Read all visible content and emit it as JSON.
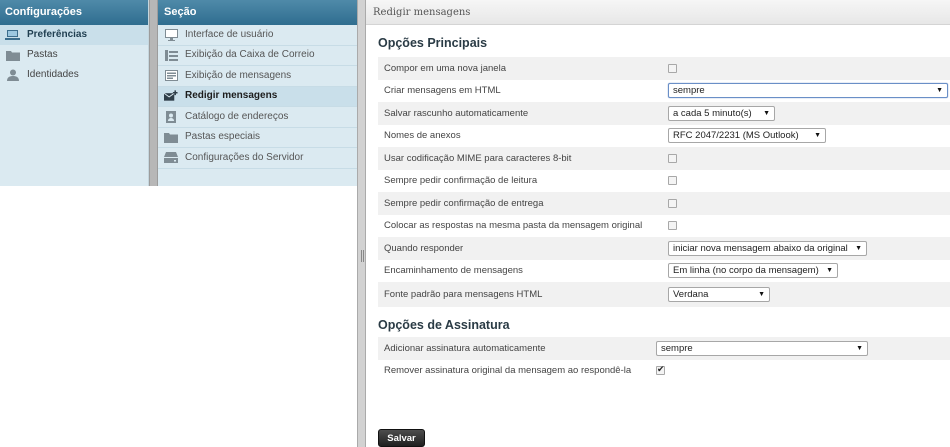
{
  "config": {
    "title": "Configurações",
    "items": [
      {
        "label": "Preferências",
        "icon": "laptop-icon"
      },
      {
        "label": "Pastas",
        "icon": "folder-icon"
      },
      {
        "label": "Identidades",
        "icon": "user-icon"
      }
    ]
  },
  "section": {
    "title": "Seção",
    "items": [
      {
        "label": "Interface de usuário",
        "icon": "monitor-icon"
      },
      {
        "label": "Exibição da Caixa de Correio",
        "icon": "mailbox-view-icon"
      },
      {
        "label": "Exibição de mensagens",
        "icon": "message-view-icon"
      },
      {
        "label": "Redigir mensagens",
        "icon": "compose-icon"
      },
      {
        "label": "Catálogo de endereços",
        "icon": "address-book-icon"
      },
      {
        "label": "Pastas especiais",
        "icon": "folder-icon"
      },
      {
        "label": "Configurações do Servidor",
        "icon": "server-icon"
      }
    ]
  },
  "main": {
    "title": "Redigir mensagens",
    "main_options": {
      "title": "Opções Principais",
      "rows": [
        {
          "label": "Compor em uma nova janela",
          "checked": false
        },
        {
          "label": "Criar mensagens em HTML",
          "value": "sempre"
        },
        {
          "label": "Salvar rascunho automaticamente",
          "value": "a cada 5 minuto(s)"
        },
        {
          "label": "Nomes de anexos",
          "value": "RFC 2047/2231 (MS Outlook)"
        },
        {
          "label": "Usar codificação MIME para caracteres 8-bit",
          "checked": false
        },
        {
          "label": "Sempre pedir confirmação de leitura",
          "checked": false
        },
        {
          "label": "Sempre pedir confirmação de entrega",
          "checked": false
        },
        {
          "label": "Colocar as respostas na mesma pasta da mensagem original",
          "checked": false
        },
        {
          "label": "Quando responder",
          "value": "iniciar nova mensagem abaixo da original"
        },
        {
          "label": "Encaminhamento de mensagens",
          "value": "Em linha (no corpo da mensagem)"
        },
        {
          "label": "Fonte padrão para mensagens HTML",
          "value": "Verdana"
        }
      ]
    },
    "signature_options": {
      "title": "Opções de Assinatura",
      "rows": [
        {
          "label": "Adicionar assinatura automaticamente",
          "value": "sempre"
        },
        {
          "label": "Remover assinatura original da mensagem ao respondê-la",
          "checked": true
        }
      ]
    },
    "save_label": "Salvar"
  }
}
